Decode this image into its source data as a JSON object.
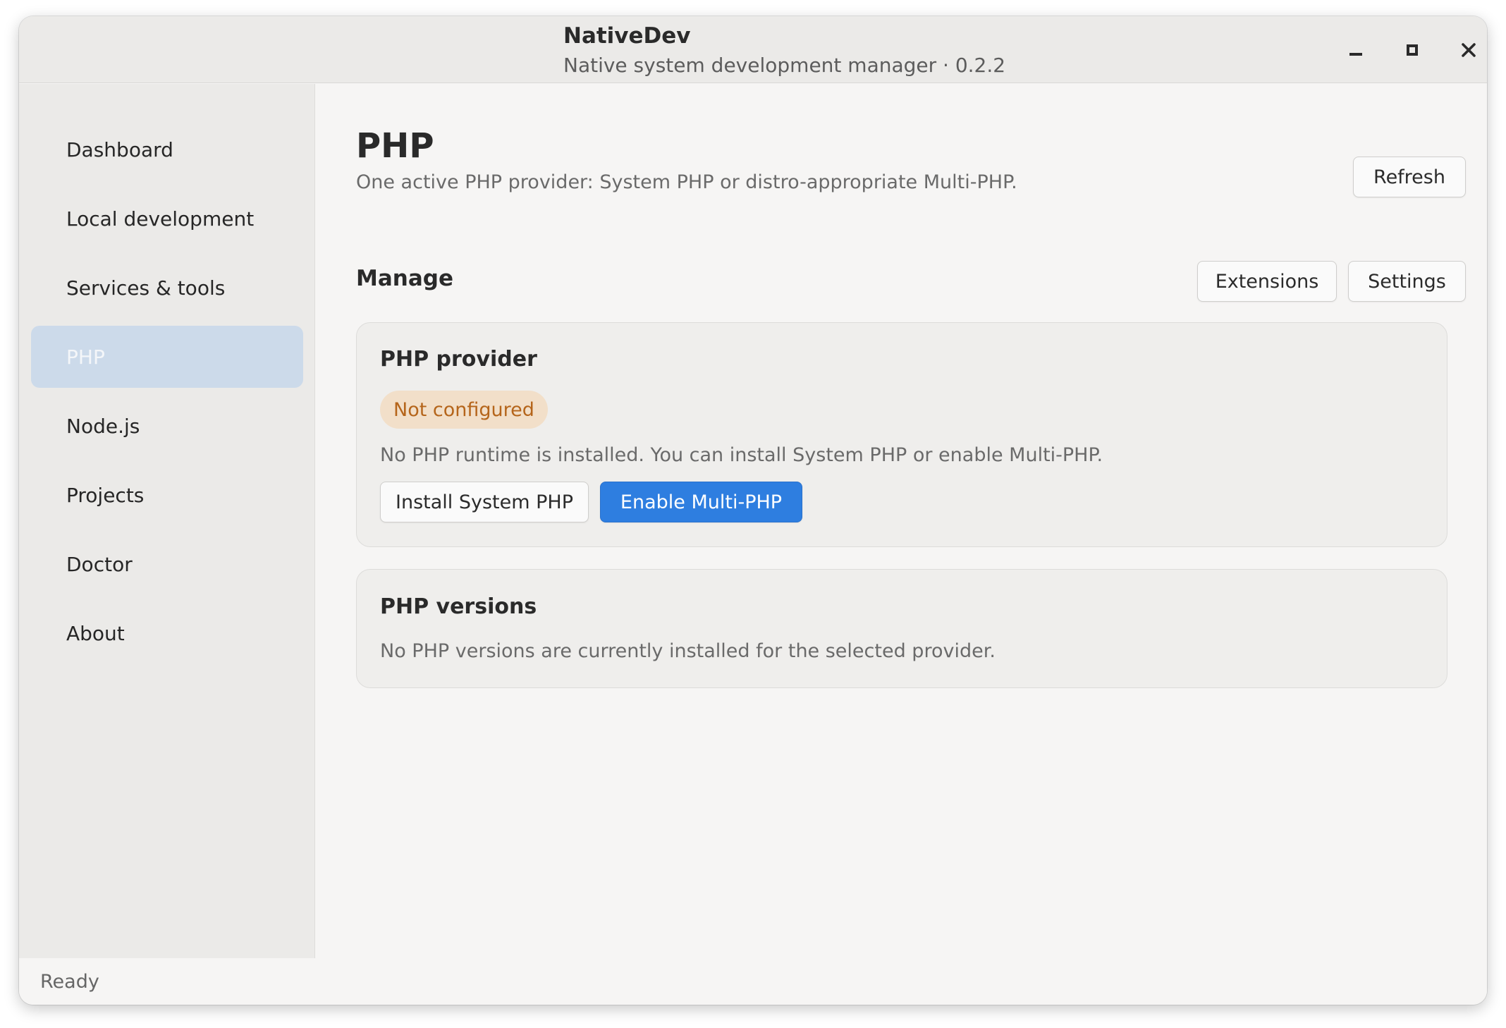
{
  "window": {
    "title": "NativeDev",
    "subtitle": "Native system development manager · 0.2.2"
  },
  "window_controls": {
    "minimize": "minimize-icon",
    "maximize": "maximize-icon",
    "close": "close-icon"
  },
  "sidebar": {
    "items": [
      {
        "label": "Dashboard"
      },
      {
        "label": "Local development"
      },
      {
        "label": "Services & tools"
      },
      {
        "label": "PHP",
        "active": true
      },
      {
        "label": "Node.js"
      },
      {
        "label": "Projects"
      },
      {
        "label": "Doctor"
      },
      {
        "label": "About"
      }
    ]
  },
  "header": {
    "title": "PHP",
    "description": "One active PHP provider: System PHP or distro-appropriate Multi-PHP.",
    "refresh_label": "Refresh"
  },
  "manage": {
    "title": "Manage",
    "extensions_label": "Extensions",
    "settings_label": "Settings"
  },
  "provider_card": {
    "title": "PHP provider",
    "status": "Not configured",
    "message": "No PHP runtime is installed. You can install System PHP or enable Multi-PHP.",
    "install_label": "Install System PHP",
    "enable_label": "Enable Multi-PHP"
  },
  "versions_card": {
    "title": "PHP versions",
    "message": "No PHP versions are currently installed for the selected provider."
  },
  "statusbar": {
    "text": "Ready"
  },
  "colors": {
    "accent": "#2e7ee0",
    "active_nav": "#ccdaea",
    "warning_badge_bg": "#f2dfc9",
    "warning_badge_text": "#b5651b"
  }
}
